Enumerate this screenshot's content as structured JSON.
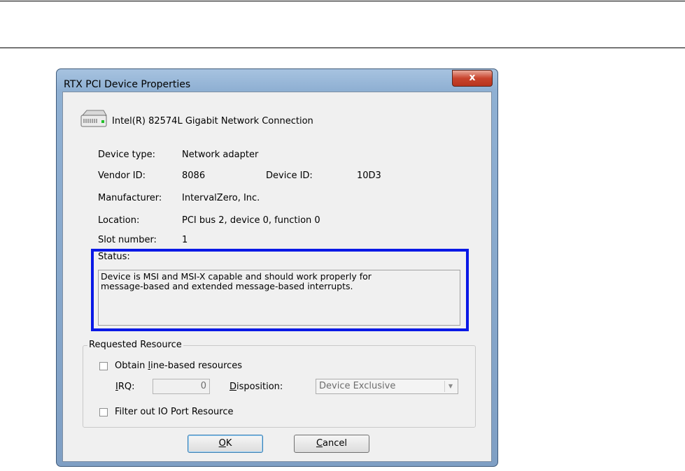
{
  "window": {
    "title": "RTX PCI Device Properties",
    "close_label": "x"
  },
  "device": {
    "name": "Intel(R) 82574L Gigabit Network Connection",
    "icon": "network-adapter-icon"
  },
  "fields": {
    "device_type_label": "Device type:",
    "device_type_value": "Network adapter",
    "vendor_id_label": "Vendor ID:",
    "vendor_id_value": "8086",
    "device_id_label": "Device ID:",
    "device_id_value": "10D3",
    "manufacturer_label": "Manufacturer:",
    "manufacturer_value": "IntervalZero, Inc.",
    "location_label": "Location:",
    "location_value": "PCI bus 2, device 0, function 0",
    "slot_label": "Slot number:",
    "slot_value": "1"
  },
  "status": {
    "label": "Status:",
    "text": "Device is MSI and MSI-X capable and should work properly for\nmessage-based and extended message-based interrupts."
  },
  "requested_resource": {
    "group_label": "Requested Resource",
    "obtain_line_based_label_pre": "Obtain ",
    "obtain_line_based_label_key": "l",
    "obtain_line_based_label_post": "ine-based resources",
    "irq_label_key": "I",
    "irq_label_post": "RQ:",
    "irq_value": "0",
    "disposition_label_key": "D",
    "disposition_label_post": "isposition:",
    "disposition_value": "Device Exclusive",
    "filter_io_label": "Filter out IO Port Resource"
  },
  "buttons": {
    "ok_key": "O",
    "ok_post": "K",
    "cancel_key": "C",
    "cancel_post": "ancel"
  },
  "colors": {
    "highlight_border": "#0a19e6",
    "close_button": "#c8442d"
  }
}
